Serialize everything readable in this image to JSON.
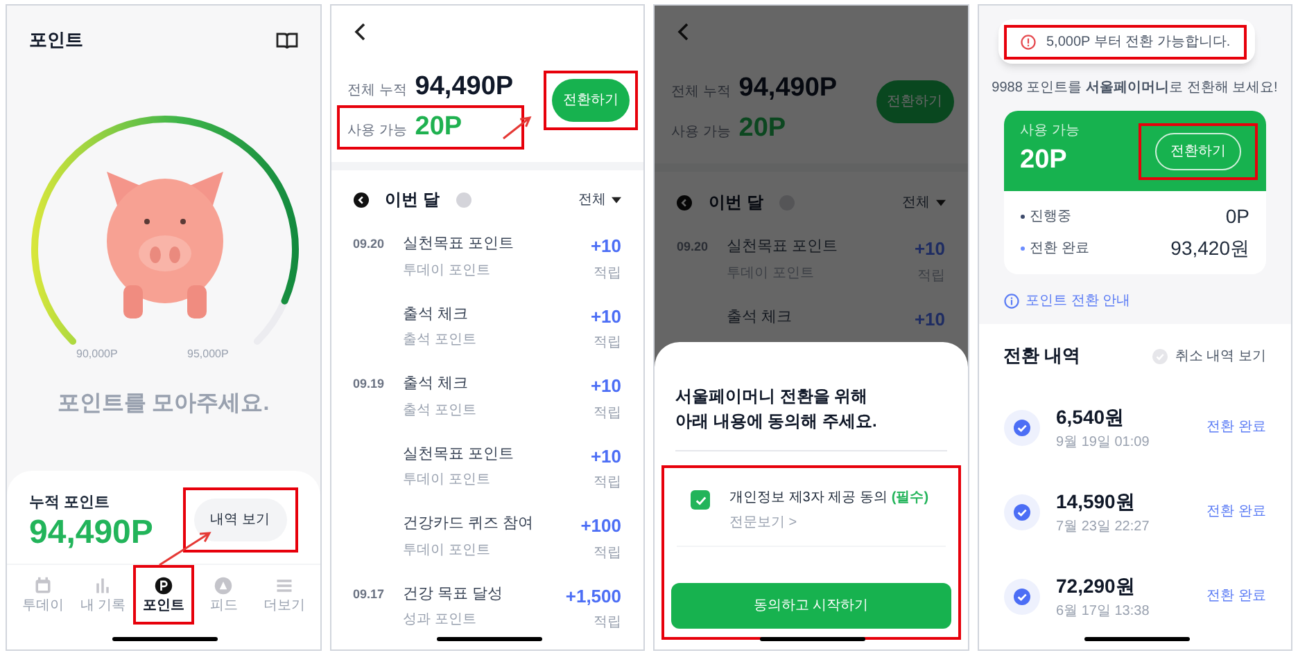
{
  "panels": [
    {
      "kind": "home",
      "title": "포인트",
      "gauge": {
        "min_label": "90,000P",
        "max_label": "95,000P"
      },
      "message": "포인트를 모아주세요.",
      "summary": {
        "label": "누적 포인트",
        "value": "94,490P",
        "button": {
          "label": "내역 보기",
          "highlighted": true
        }
      },
      "tabs": [
        {
          "label": "투데이",
          "selected": false,
          "highlighted": false
        },
        {
          "label": "내 기록",
          "selected": false,
          "highlighted": false
        },
        {
          "label": "포인트",
          "selected": true,
          "highlighted": true
        },
        {
          "label": "피드",
          "selected": false,
          "highlighted": false
        },
        {
          "label": "더보기",
          "selected": false,
          "highlighted": false
        }
      ]
    },
    {
      "kind": "history",
      "total_label": "전체 누적",
      "total": "94,490P",
      "available_label": "사용 가능",
      "available": "20P",
      "available_highlighted": true,
      "convert_button": {
        "label": "전환하기",
        "highlighted": true
      },
      "month": "이번 달",
      "filter": "전체",
      "rows": [
        {
          "date": "09.20",
          "title": "실천목표 포인트",
          "sub": "투데이 포인트",
          "amount": "+10",
          "type": "적립"
        },
        {
          "title": "출석 체크",
          "sub": "출석 포인트",
          "amount": "+10",
          "type": "적립"
        },
        {
          "date": "09.19",
          "title": "출석 체크",
          "sub": "출석 포인트",
          "amount": "+10",
          "type": "적립"
        },
        {
          "title": "실천목표 포인트",
          "sub": "투데이 포인트",
          "amount": "+10",
          "type": "적립"
        },
        {
          "title": "건강카드 퀴즈 참여",
          "sub": "투데이 포인트",
          "amount": "+100",
          "type": "적립"
        },
        {
          "date": "09.17",
          "title": "건강 목표 달성",
          "sub": "성과 포인트",
          "amount": "+1,500",
          "type": "적립"
        }
      ]
    },
    {
      "kind": "consent",
      "background": {
        "total_label": "전체 누적",
        "total": "94,490P",
        "available_label": "사용 가능",
        "available": "20P",
        "convert_button": {
          "label": "전환하기"
        },
        "month": "이번 달",
        "filter": "전체",
        "rows": [
          {
            "date": "09.20",
            "title": "실천목표 포인트",
            "sub": "투데이 포인트",
            "amount": "+10",
            "type": "적립"
          },
          {
            "title": "출석 체크",
            "amount": "+10"
          }
        ]
      },
      "sheet": {
        "title": "서울페이머니 전환을 위해\n아래 내용에 동의해 주세요.",
        "highlighted": true,
        "consent": {
          "label": "개인정보 제3자 제공 동의",
          "required": "(필수)",
          "checked": true,
          "link": "전문보기 >"
        },
        "button": "동의하고 시작하기"
      }
    },
    {
      "kind": "convert",
      "toast": {
        "text": "5,000P 부터 전환 가능합니다.",
        "highlighted": true
      },
      "subtitle": "9988 포인트를 **서울페이머니**로 전환해 보세요!",
      "card": {
        "label": "사용 가능",
        "value": "20P",
        "button": {
          "label": "전환하기",
          "highlighted": true
        },
        "stats": [
          {
            "label": "진행중",
            "value": "0P",
            "color": "#3d4a6b"
          },
          {
            "label": "전환 완료",
            "value": "93,420원",
            "color": "#6b8cff"
          }
        ]
      },
      "guide_link": "포인트 전환 안내",
      "history_title": "전환 내역",
      "cancel_filter": {
        "label": "취소 내역 보기",
        "checked": false
      },
      "items": [
        {
          "amount": "6,540원",
          "date": "9월 19일 01:09",
          "status": "전환 완료"
        },
        {
          "amount": "14,590원",
          "date": "7월 23일 22:27",
          "status": "전환 완료"
        },
        {
          "amount": "72,290원",
          "date": "6월 17일 13:38",
          "status": "전환 완료"
        }
      ]
    }
  ]
}
